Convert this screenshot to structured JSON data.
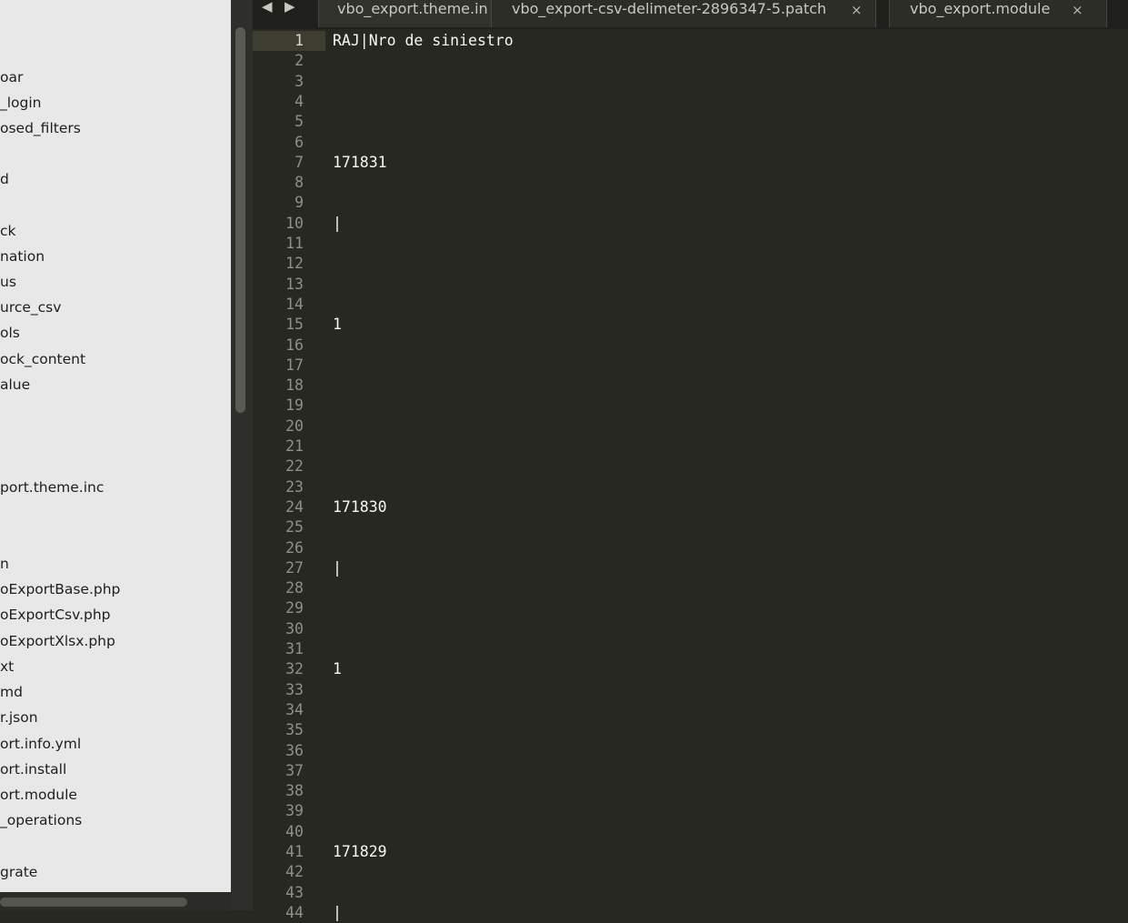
{
  "sidebar": {
    "items": [
      {
        "label": "oar"
      },
      {
        "label": "_login"
      },
      {
        "label": "osed_filters"
      },
      {
        "label": "d"
      },
      {
        "label": "ck"
      },
      {
        "label": "nation"
      },
      {
        "label": "us"
      },
      {
        "label": "urce_csv"
      },
      {
        "label": "ols"
      },
      {
        "label": "ock_content"
      },
      {
        "label": "alue"
      },
      {
        "label": "port.theme.inc"
      },
      {
        "label": "n"
      },
      {
        "label": "oExportBase.php"
      },
      {
        "label": "oExportCsv.php"
      },
      {
        "label": "oExportXlsx.php"
      },
      {
        "label": "xt"
      },
      {
        "label": "md"
      },
      {
        "label": "r.json"
      },
      {
        "label": "ort.info.yml"
      },
      {
        "label": "ort.install"
      },
      {
        "label": "ort.module"
      },
      {
        "label": "_operations"
      },
      {
        "label": "grate"
      }
    ]
  },
  "tabbar": {
    "prev_icon": "◀",
    "next_icon": "▶",
    "close_icon": "×",
    "tabs": [
      {
        "label": "vbo_export.theme.in"
      },
      {
        "label": "vbo_export-csv-delimeter-2896347-5.patch"
      },
      {
        "label": "vbo_export.module"
      }
    ]
  },
  "editor": {
    "active_line": 1,
    "lines": [
      {
        "n": "1",
        "text": "RAJ|Nro de siniestro"
      },
      {
        "n": "2",
        "text": ""
      },
      {
        "n": "3",
        "text": ""
      },
      {
        "n": "4",
        "text": ""
      },
      {
        "n": "5",
        "text": ""
      },
      {
        "n": "6",
        "text": ""
      },
      {
        "n": "7",
        "text": "171831"
      },
      {
        "n": "8",
        "text": ""
      },
      {
        "n": "9",
        "text": ""
      },
      {
        "n": "10",
        "text": "|"
      },
      {
        "n": "11",
        "text": ""
      },
      {
        "n": "12",
        "text": ""
      },
      {
        "n": "13",
        "text": ""
      },
      {
        "n": "14",
        "text": ""
      },
      {
        "n": "15",
        "text": "1"
      },
      {
        "n": "16",
        "text": ""
      },
      {
        "n": "17",
        "text": ""
      },
      {
        "n": "18",
        "text": ""
      },
      {
        "n": "19",
        "text": ""
      },
      {
        "n": "20",
        "text": ""
      },
      {
        "n": "21",
        "text": ""
      },
      {
        "n": "22",
        "text": ""
      },
      {
        "n": "23",
        "text": ""
      },
      {
        "n": "24",
        "text": "171830"
      },
      {
        "n": "25",
        "text": ""
      },
      {
        "n": "26",
        "text": ""
      },
      {
        "n": "27",
        "text": "|"
      },
      {
        "n": "28",
        "text": ""
      },
      {
        "n": "29",
        "text": ""
      },
      {
        "n": "30",
        "text": ""
      },
      {
        "n": "31",
        "text": ""
      },
      {
        "n": "32",
        "text": "1"
      },
      {
        "n": "33",
        "text": ""
      },
      {
        "n": "34",
        "text": ""
      },
      {
        "n": "35",
        "text": ""
      },
      {
        "n": "36",
        "text": ""
      },
      {
        "n": "37",
        "text": ""
      },
      {
        "n": "38",
        "text": ""
      },
      {
        "n": "39",
        "text": ""
      },
      {
        "n": "40",
        "text": ""
      },
      {
        "n": "41",
        "text": "171829"
      },
      {
        "n": "42",
        "text": ""
      },
      {
        "n": "43",
        "text": ""
      },
      {
        "n": "44",
        "text": "|"
      }
    ]
  }
}
